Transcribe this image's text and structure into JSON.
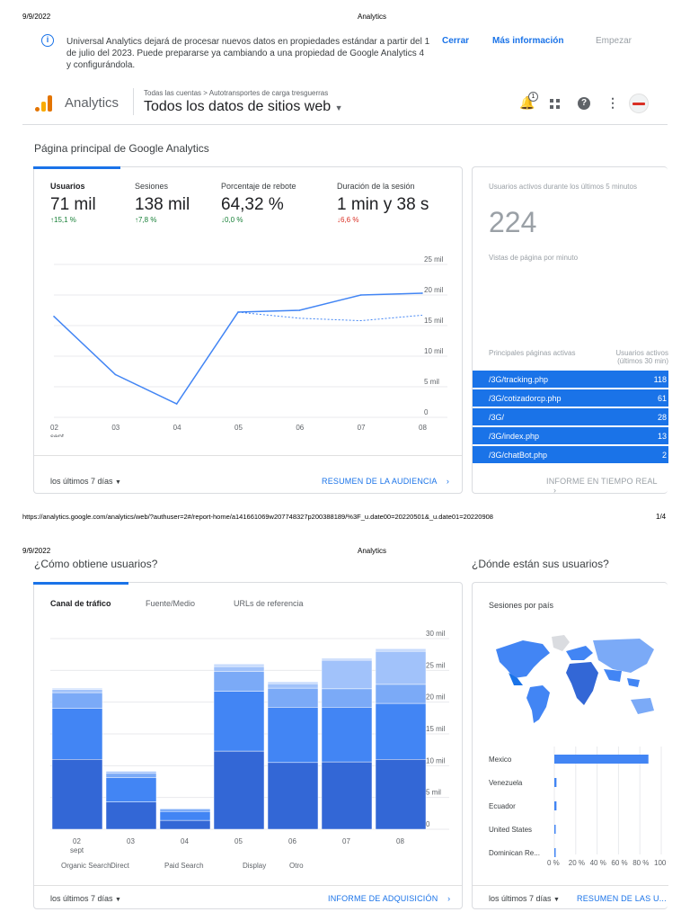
{
  "print": {
    "date": "9/9/2022",
    "title": "Analytics",
    "url": "https://analytics.google.com/analytics/web/?authuser=2#/report-home/a141661069w207748327p200388189/%3F_u.date00=20220501&_u.date01=20220908",
    "page1": "1/4"
  },
  "notice": {
    "text": "Universal Analytics dejará de procesar nuevos datos en propiedades estándar a partir del 1 de julio del 2023. Puede prepararse ya cambiando a una propiedad de Google Analytics 4 y configurándola.",
    "close": "Cerrar",
    "more": "Más información",
    "start": "Empezar"
  },
  "header": {
    "product": "Analytics",
    "breadcrumb_1": "Todas las cuentas",
    "breadcrumb_sep": ">",
    "breadcrumb_2": "Autotransportes de carga tresguerras",
    "view": "Todos los datos de sitios web",
    "notif_count": "1"
  },
  "page_title": "Página principal de Google Analytics",
  "metrics": [
    {
      "label": "Usuarios",
      "value": "71 mil",
      "delta": "15,1 %",
      "dir": "up"
    },
    {
      "label": "Sesiones",
      "value": "138 mil",
      "delta": "7,8 %",
      "dir": "up"
    },
    {
      "label": "Porcentaje de rebote",
      "value": "64,32 %",
      "delta": "0,0 %",
      "dir": "down-green"
    },
    {
      "label": "Duración de la sesión",
      "value": "1 min y 38 s",
      "delta": "6,6 %",
      "dir": "down"
    }
  ],
  "line_chart": {
    "y_ticks": [
      "25 mil",
      "20 mil",
      "15 mil",
      "10 mil",
      "5 mil",
      "0"
    ],
    "x_ticks": [
      "02",
      "03",
      "04",
      "05",
      "06",
      "07",
      "08"
    ],
    "x_sub": "sept"
  },
  "card1_footer": {
    "range": "los últimos 7 días",
    "link": "RESUMEN DE LA AUDIENCIA"
  },
  "realtime": {
    "title": "Usuarios activos durante los últimos 5 minutos",
    "value": "224",
    "pageviews": "Vistas de página por minuto",
    "col1": "Principales páginas activas",
    "col2": "Usuarios activos (últimos 30 min)",
    "rows": [
      {
        "page": "/3G/tracking.php",
        "users": "118"
      },
      {
        "page": "/3G/cotizadorcp.php",
        "users": "61"
      },
      {
        "page": "/3G/",
        "users": "28"
      },
      {
        "page": "/3G/index.php",
        "users": "13"
      },
      {
        "page": "/3G/chatBot.php",
        "users": "2"
      }
    ],
    "link": "INFORME EN TIEMPO REAL"
  },
  "acq": {
    "title": "¿Cómo obtiene usuarios?",
    "tabs": [
      "Canal de tráfico",
      "Fuente/Medio",
      "URLs de referencia"
    ],
    "y_ticks": [
      "30 mil",
      "25 mil",
      "20 mil",
      "15 mil",
      "10 mil",
      "5 mil",
      "0"
    ],
    "x_ticks": [
      "02",
      "03",
      "04",
      "05",
      "06",
      "07",
      "08"
    ],
    "x_sub": "sept",
    "legend": [
      "Organic Search",
      "Direct",
      "Paid Search",
      "Display",
      "Otro"
    ],
    "footer_range": "los últimos 7 días",
    "footer_link": "INFORME DE ADQUISICIÓN"
  },
  "geo": {
    "title": "¿Dónde están sus usuarios?",
    "subtitle": "Sesiones por país",
    "countries": [
      "Mexico",
      "Venezuela",
      "Ecuador",
      "United States",
      "Dominican Re..."
    ],
    "x_ticks": [
      "0 %",
      "20 %",
      "40 %",
      "60 %",
      "80 %",
      "100 %"
    ],
    "footer_range": "los últimos 7 días",
    "footer_link": "RESUMEN DE LAS U..."
  },
  "chart_data": [
    {
      "type": "line",
      "title": "",
      "x": [
        "02 sept",
        "03",
        "04",
        "05",
        "06",
        "07",
        "08"
      ],
      "series": [
        {
          "values": [
            16500,
            7000,
            2200,
            17200,
            17500,
            20000,
            20300
          ]
        },
        {
          "values": [
            null,
            null,
            null,
            17200,
            16200,
            15800,
            16700
          ]
        }
      ],
      "ylim": [
        0,
        25000
      ]
    },
    {
      "type": "bar",
      "categories": [
        "02 sept",
        "03",
        "04",
        "05",
        "06",
        "07",
        "08"
      ],
      "series": [
        {
          "name": "Organic Search",
          "values": [
            11000,
            4300,
            1400,
            12300,
            10500,
            10600,
            11000
          ]
        },
        {
          "name": "Direct",
          "values": [
            8000,
            3800,
            1400,
            9400,
            8700,
            8600,
            8800
          ]
        },
        {
          "name": "Paid Search",
          "values": [
            2500,
            700,
            350,
            3100,
            3000,
            2900,
            3000
          ]
        },
        {
          "name": "Display",
          "values": [
            500,
            300,
            150,
            800,
            700,
            4500,
            5200
          ]
        },
        {
          "name": "Otro",
          "values": [
            200,
            100,
            50,
            400,
            300,
            300,
            400
          ]
        }
      ],
      "ylim": [
        0,
        30000
      ]
    },
    {
      "type": "bar",
      "categories": [
        "Mexico",
        "Venezuela",
        "Ecuador",
        "United States",
        "Dominican Re..."
      ],
      "values": [
        88,
        2,
        2,
        1,
        1
      ],
      "xlim": [
        0,
        100
      ]
    }
  ],
  "colors": {
    "accent": "#1a73e8",
    "bar1": "#3367d6",
    "bar2": "#4285f4",
    "bar3": "#7baaf7",
    "bar4": "#a1c2fa",
    "bar5": "#c6dafc"
  }
}
